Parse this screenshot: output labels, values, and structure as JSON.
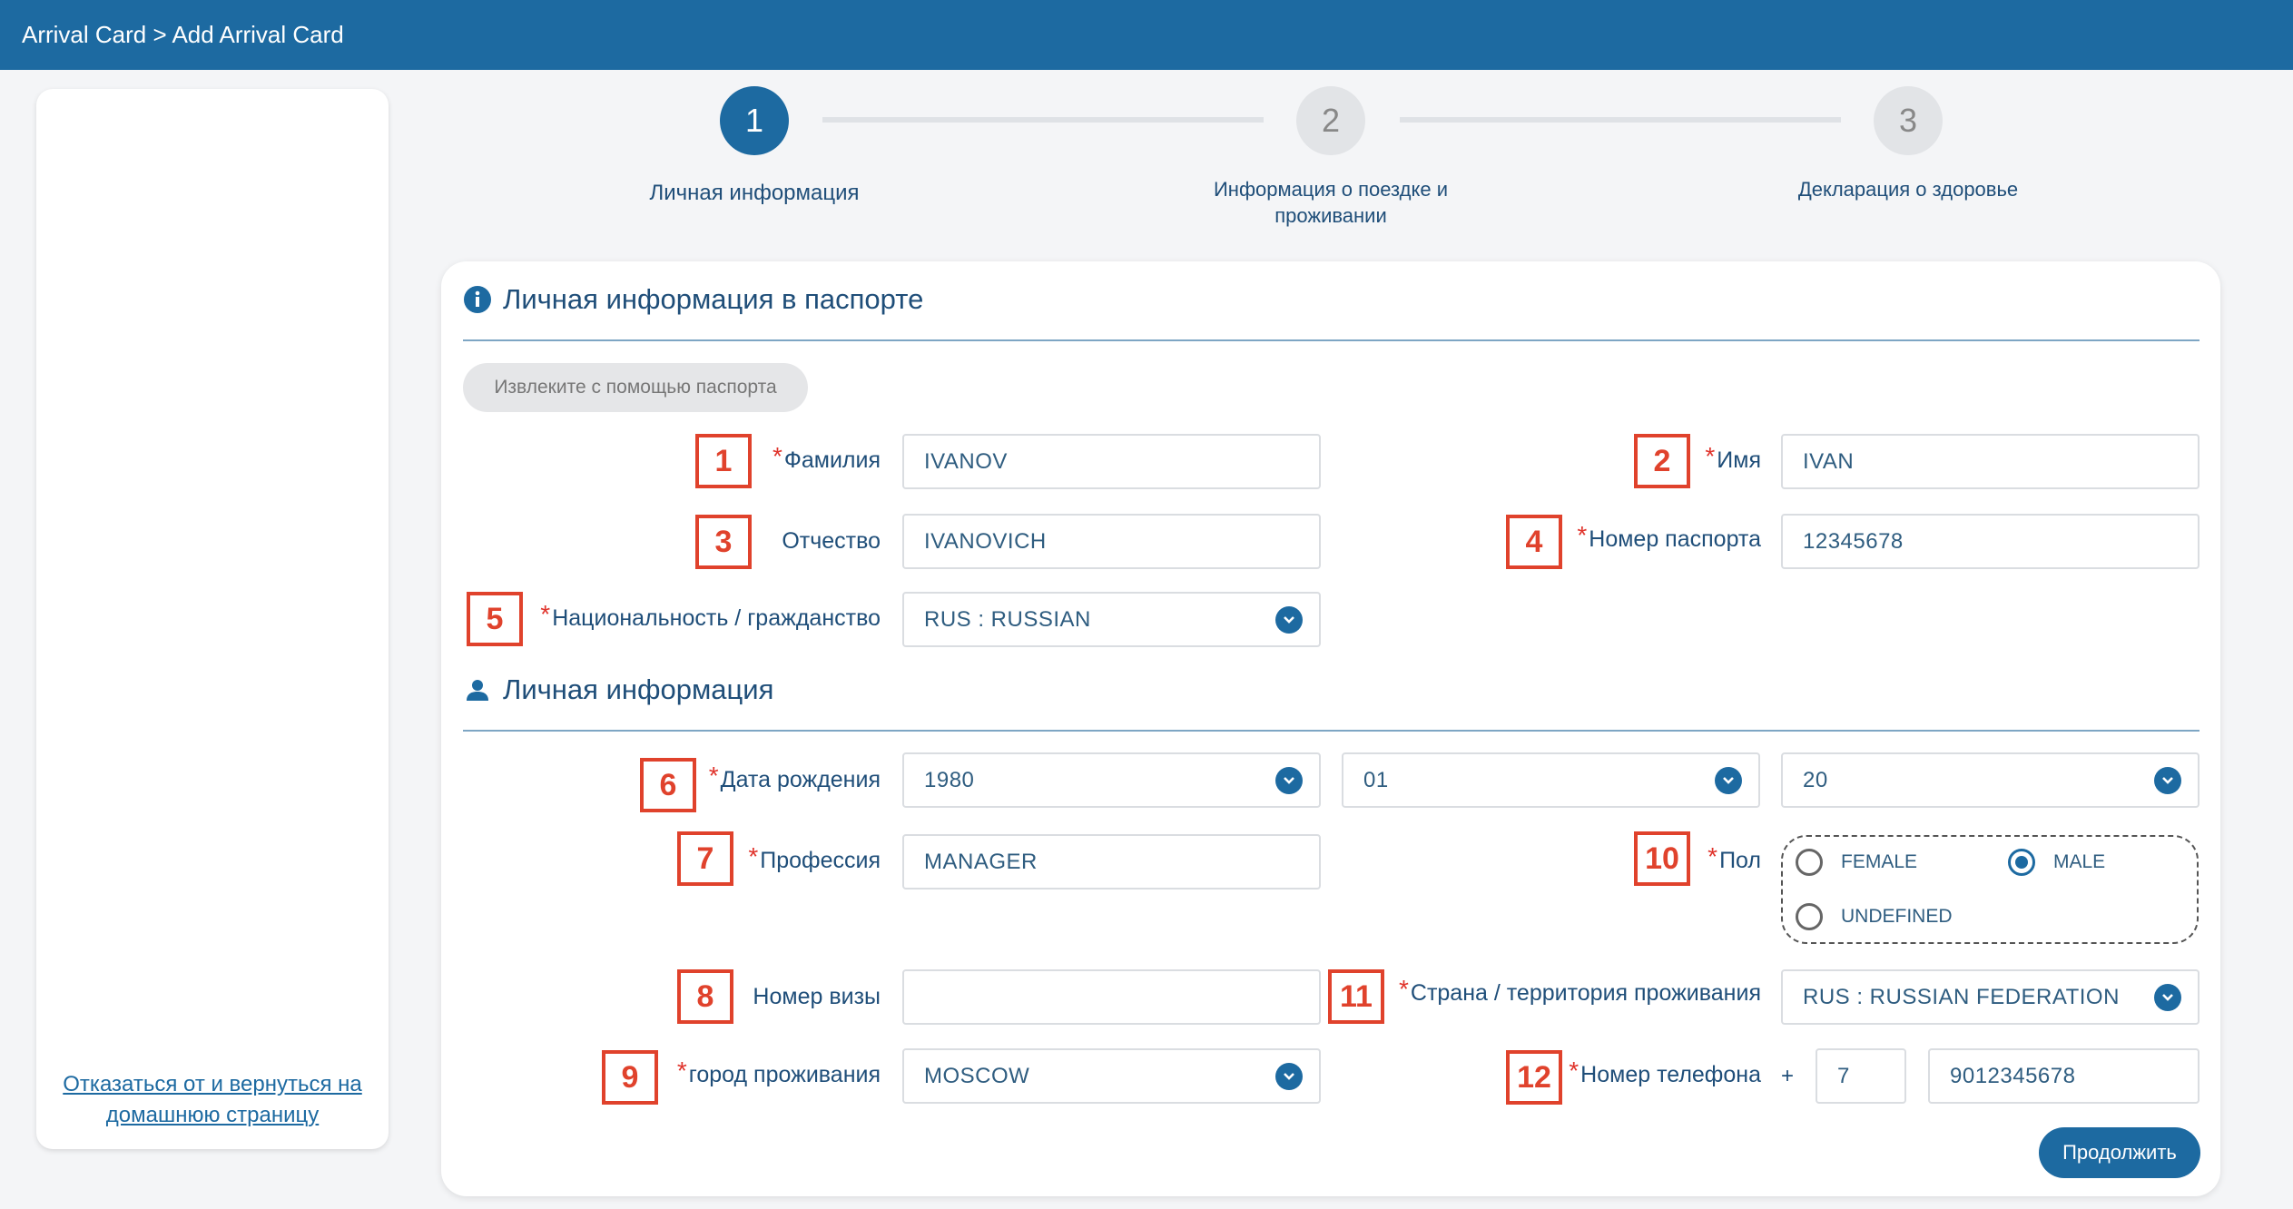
{
  "header": {
    "breadcrumb": "Arrival Card > Add Arrival Card"
  },
  "sidebar": {
    "cancel_link": "Отказаться от и вернуться на домашнюю страницу"
  },
  "steps": [
    {
      "number": "1",
      "label": "Личная информация",
      "state": "active"
    },
    {
      "number": "2",
      "label": "Информация о поездке и проживании",
      "state": "inactive"
    },
    {
      "number": "3",
      "label": "Декларация о здоровье",
      "state": "inactive"
    }
  ],
  "passport_section": {
    "title": "Личная информация в паспорте",
    "icon": "info-circle-icon",
    "extract_button": "Извлеките с помощью паспорта"
  },
  "personal_section": {
    "title": "Личная информация",
    "icon": "person-icon"
  },
  "fields": {
    "surname": {
      "badge": "1",
      "label": "Фамилия",
      "required": true,
      "value": "IVANOV"
    },
    "name": {
      "badge": "2",
      "label": "Имя",
      "required": true,
      "value": "IVAN"
    },
    "patronymic": {
      "badge": "3",
      "label": "Отчество",
      "required": false,
      "value": "IVANOVICH"
    },
    "passport_number": {
      "badge": "4",
      "label": "Номер паспорта",
      "required": true,
      "value": "12345678"
    },
    "nationality": {
      "badge": "5",
      "label": "Национальность / гражданство",
      "required": true,
      "value": "RUS : RUSSIAN"
    },
    "birth_date": {
      "badge": "6",
      "label": "Дата рождения",
      "required": true,
      "year": "1980",
      "month": "01",
      "day": "20"
    },
    "profession": {
      "badge": "7",
      "label": "Профессия",
      "required": true,
      "value": "MANAGER"
    },
    "visa_number": {
      "badge": "8",
      "label": "Номер визы",
      "required": false,
      "value": ""
    },
    "city": {
      "badge": "9",
      "label": "город проживания",
      "required": true,
      "value": "MOSCOW"
    },
    "gender": {
      "badge": "10",
      "label": "Пол",
      "required": true,
      "options": [
        "FEMALE",
        "MALE",
        "UNDEFINED"
      ],
      "selected": "MALE"
    },
    "residence_country": {
      "badge": "11",
      "label": "Страна / территория проживания",
      "required": true,
      "value": "RUS : RUSSIAN FEDERATION"
    },
    "phone": {
      "badge": "12",
      "label": "Номер телефона",
      "required": true,
      "prefix": "+",
      "code": "7",
      "number": "9012345678"
    }
  },
  "continue_button": "Продолжить",
  "colors": {
    "primary": "#1d6aa1",
    "required": "#e0342c",
    "badge": "#e0422c"
  }
}
